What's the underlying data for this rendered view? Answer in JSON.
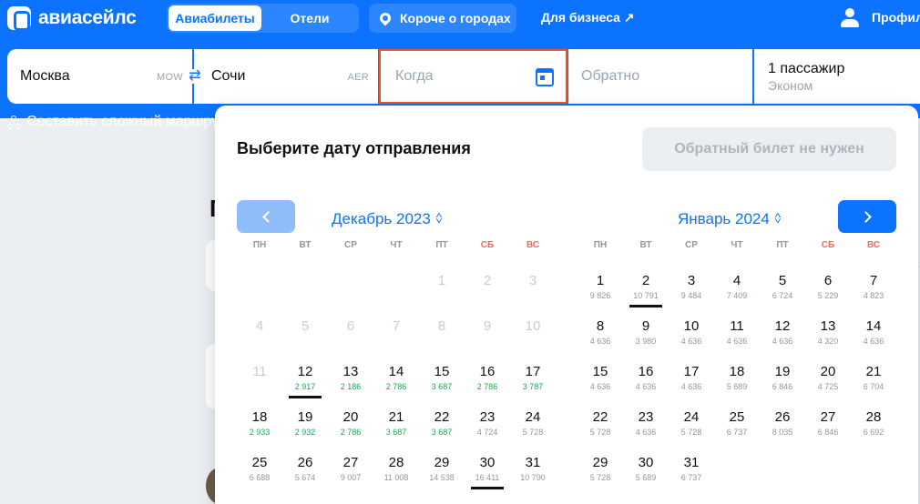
{
  "header": {
    "brand": "авиасейлс",
    "tabs": [
      {
        "label": "Авиабилеты",
        "active": true
      },
      {
        "label": "Отели",
        "active": false
      }
    ],
    "city_button": "Короче о городах",
    "business": "Для бизнеса ↗",
    "profile": "Профиль",
    "accent_color": "#0c73fe"
  },
  "search": {
    "from_city": "Москва",
    "from_code": "MOW",
    "swap_glyph": "⇄",
    "to_city": "Сочи",
    "to_code": "AER",
    "when_placeholder": "Когда",
    "back_placeholder": "Обратно",
    "passengers": "1 пассажир",
    "class": "Эконом",
    "complex_route": "Составить сложный маршрут"
  },
  "calendar": {
    "title": "Выберите дату отправления",
    "no_return": "Обратный билет не нужен",
    "weekdays": [
      "ПН",
      "ВТ",
      "СР",
      "ЧТ",
      "ПТ",
      "СБ",
      "ВС"
    ],
    "months": [
      {
        "label": "Декабрь 2023",
        "weeks": [
          [
            null,
            null,
            null,
            null,
            {
              "day": "1",
              "disabled": true
            },
            {
              "day": "2",
              "disabled": true
            },
            {
              "day": "3",
              "disabled": true
            }
          ],
          [
            {
              "day": "4",
              "disabled": true
            },
            {
              "day": "5",
              "disabled": true
            },
            {
              "day": "6",
              "disabled": true
            },
            {
              "day": "7",
              "disabled": true
            },
            {
              "day": "8",
              "disabled": true
            },
            {
              "day": "9",
              "disabled": true
            },
            {
              "day": "10",
              "disabled": true
            }
          ],
          [
            {
              "day": "11",
              "disabled": true
            },
            {
              "day": "12",
              "price": "2 917",
              "cheap": true,
              "mark": true
            },
            {
              "day": "13",
              "price": "2 186",
              "cheap": true
            },
            {
              "day": "14",
              "price": "2 786",
              "cheap": true
            },
            {
              "day": "15",
              "price": "3 687",
              "cheap": true
            },
            {
              "day": "16",
              "price": "2 786",
              "cheap": true
            },
            {
              "day": "17",
              "price": "3 787",
              "cheap": true
            }
          ],
          [
            {
              "day": "18",
              "price": "2 933",
              "cheap": true
            },
            {
              "day": "19",
              "price": "2 932",
              "cheap": true
            },
            {
              "day": "20",
              "price": "2 786",
              "cheap": true
            },
            {
              "day": "21",
              "price": "3 687",
              "cheap": true
            },
            {
              "day": "22",
              "price": "3 687",
              "cheap": true
            },
            {
              "day": "23",
              "price": "4 724"
            },
            {
              "day": "24",
              "price": "5 728"
            }
          ],
          [
            {
              "day": "25",
              "price": "6 688"
            },
            {
              "day": "26",
              "price": "5 674"
            },
            {
              "day": "27",
              "price": "9 007"
            },
            {
              "day": "28",
              "price": "11 008"
            },
            {
              "day": "29",
              "price": "14 538"
            },
            {
              "day": "30",
              "price": "16 411",
              "mark": true
            },
            {
              "day": "31",
              "price": "10 790"
            }
          ]
        ]
      },
      {
        "label": "Январь 2024",
        "weeks": [
          [
            {
              "day": "1",
              "price": "9 826"
            },
            {
              "day": "2",
              "price": "10 791",
              "mark": true
            },
            {
              "day": "3",
              "price": "9 484"
            },
            {
              "day": "4",
              "price": "7 409"
            },
            {
              "day": "5",
              "price": "6 724"
            },
            {
              "day": "6",
              "price": "5 229"
            },
            {
              "day": "7",
              "price": "4 823"
            }
          ],
          [
            {
              "day": "8",
              "price": "4 636"
            },
            {
              "day": "9",
              "price": "3 980"
            },
            {
              "day": "10",
              "price": "4 636"
            },
            {
              "day": "11",
              "price": "4 636"
            },
            {
              "day": "12",
              "price": "4 636"
            },
            {
              "day": "13",
              "price": "4 320"
            },
            {
              "day": "14",
              "price": "4 636"
            }
          ],
          [
            {
              "day": "15",
              "price": "4 636"
            },
            {
              "day": "16",
              "price": "4 636"
            },
            {
              "day": "17",
              "price": "4 636"
            },
            {
              "day": "18",
              "price": "5 689"
            },
            {
              "day": "19",
              "price": "6 846"
            },
            {
              "day": "20",
              "price": "4 725"
            },
            {
              "day": "21",
              "price": "6 704"
            }
          ],
          [
            {
              "day": "22",
              "price": "5 728"
            },
            {
              "day": "23",
              "price": "4 636"
            },
            {
              "day": "24",
              "price": "5 728"
            },
            {
              "day": "25",
              "price": "6 737"
            },
            {
              "day": "26",
              "price": "8 035"
            },
            {
              "day": "27",
              "price": "6 846"
            },
            {
              "day": "28",
              "price": "6 692"
            }
          ],
          [
            {
              "day": "29",
              "price": "5 728"
            },
            {
              "day": "30",
              "price": "5 689"
            },
            {
              "day": "31",
              "price": "6 737"
            },
            null,
            null,
            null,
            null
          ]
        ]
      }
    ]
  }
}
